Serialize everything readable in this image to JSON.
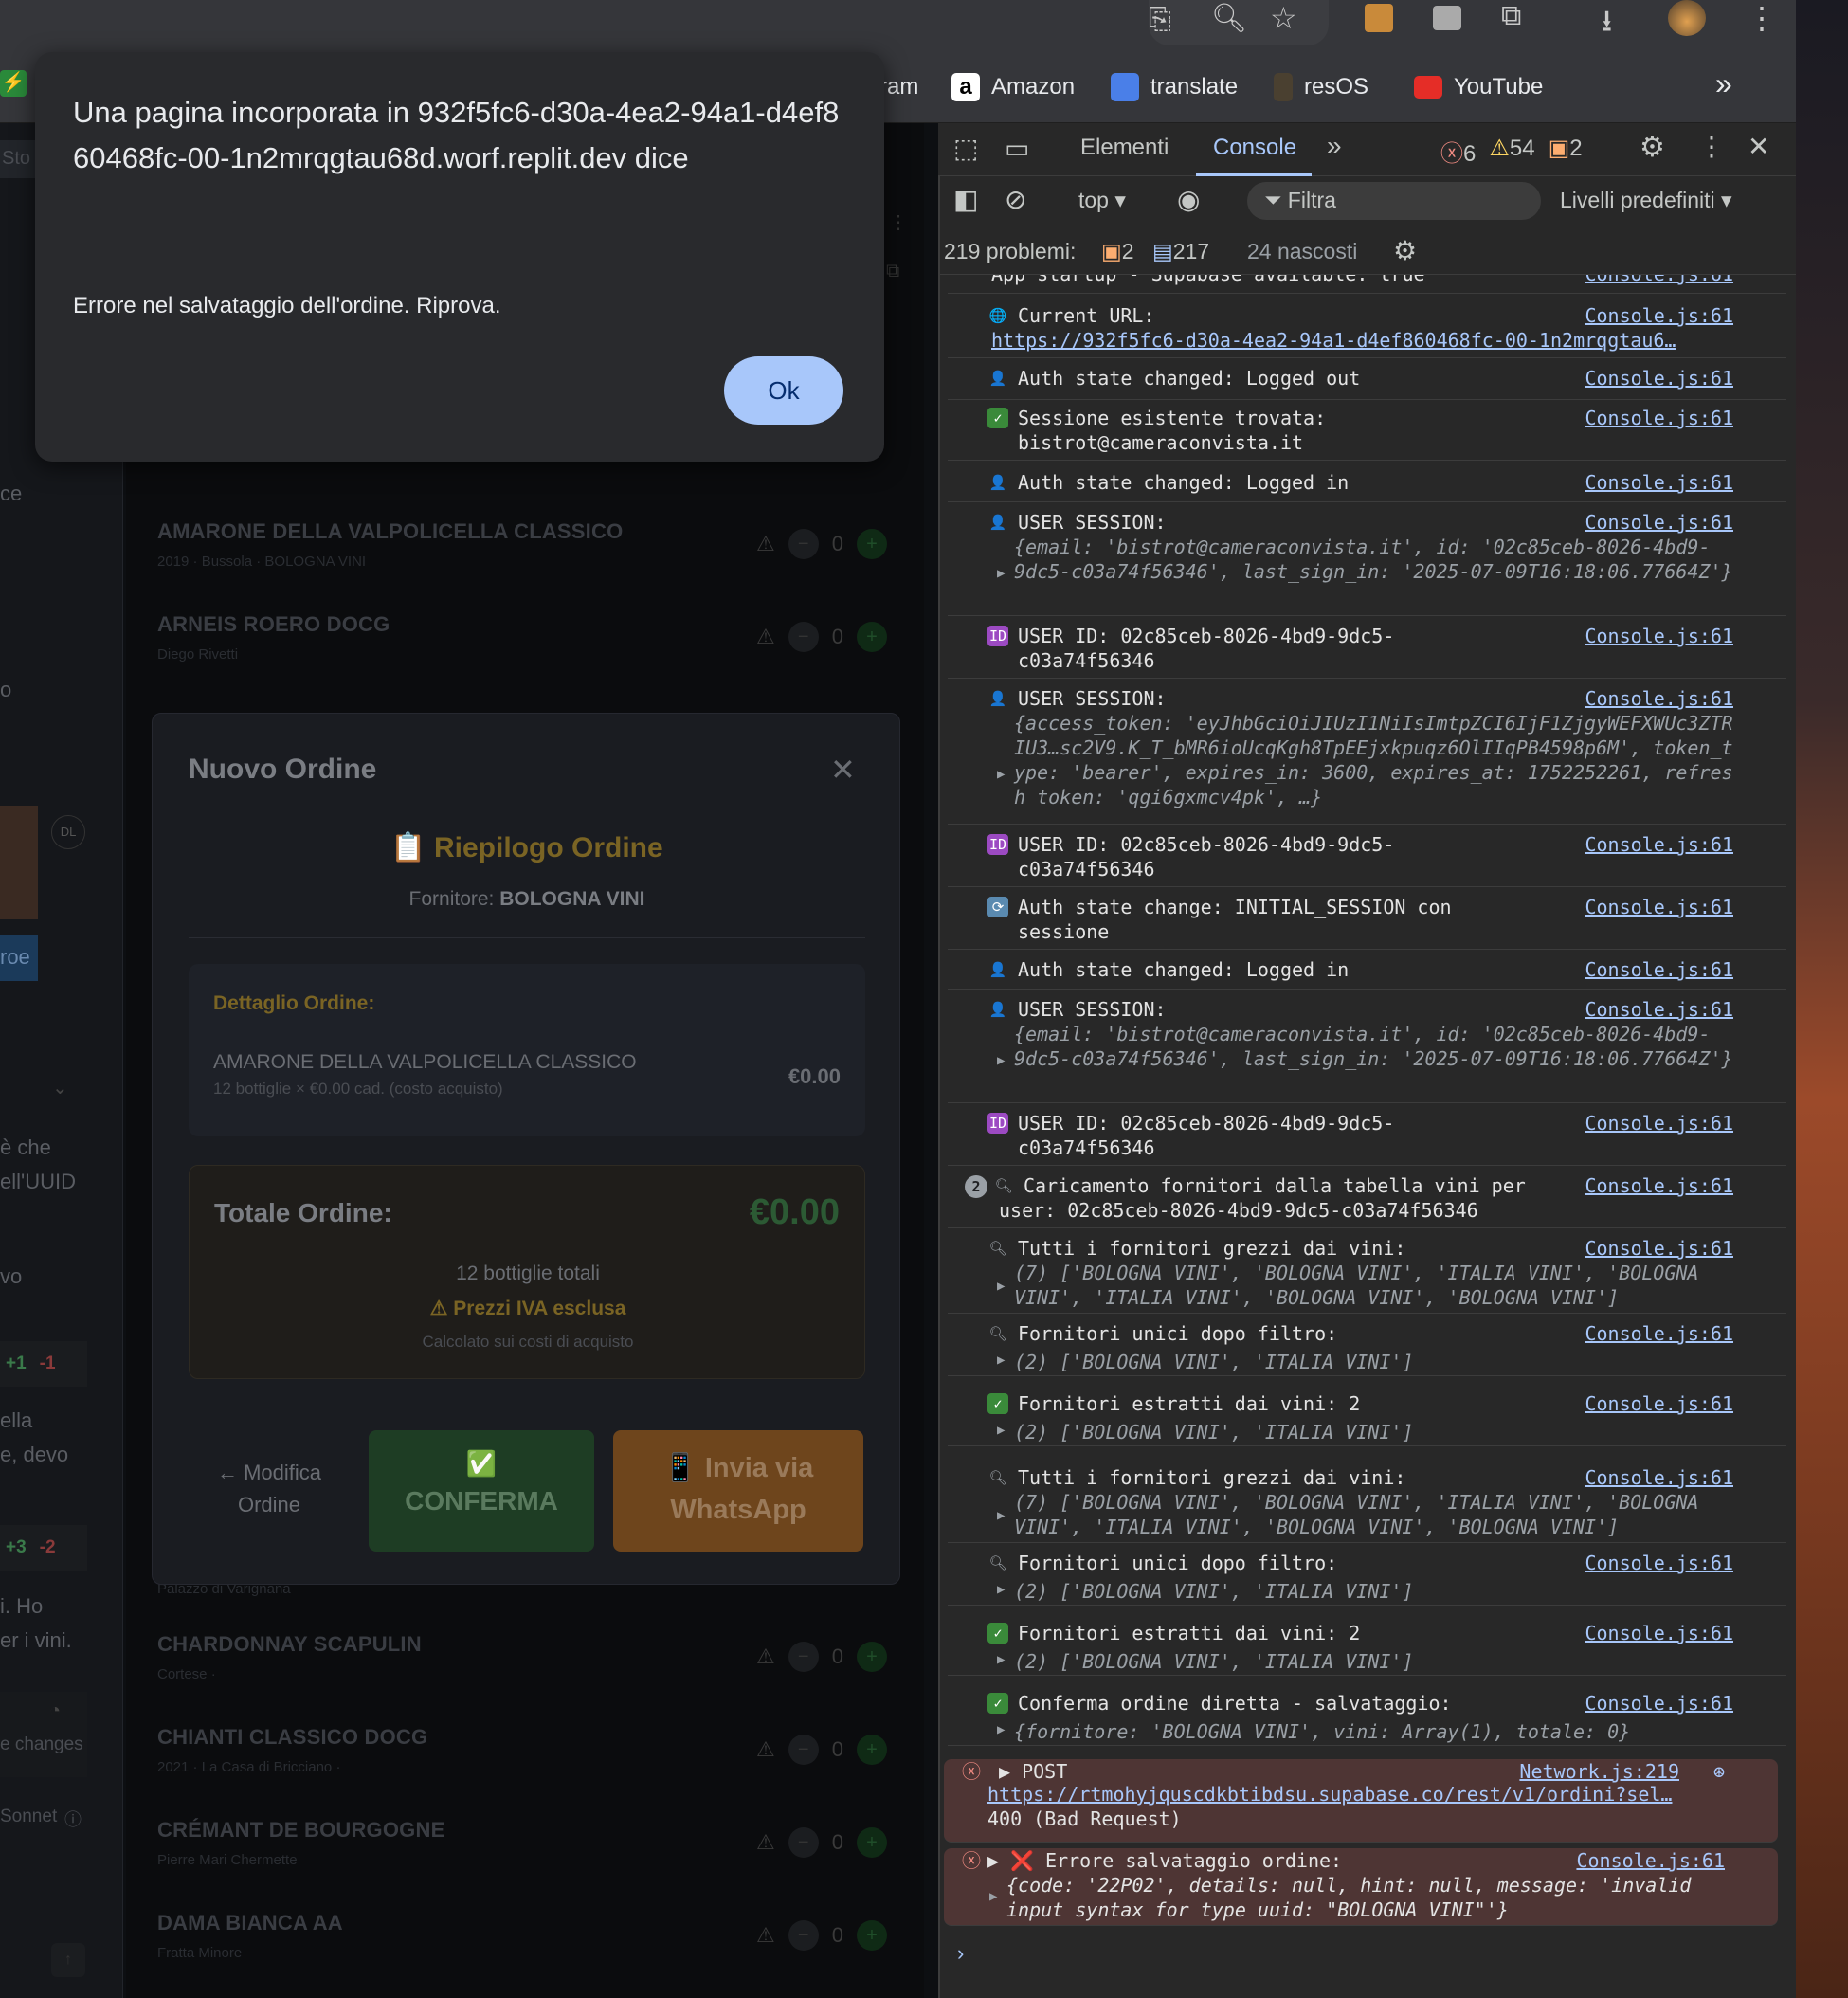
{
  "bookmarks": [
    "ram",
    "Amazon",
    "translate",
    "resOS",
    "YouTube"
  ],
  "alert": {
    "title": "Una pagina incorporata in 932f5fc6-d30a-4ea2-94a1-d4ef860468fc-00-1n2mrqgtau68d.worf.replit.dev dice",
    "message": "Errore nel salvataggio dell'ordine. Riprova.",
    "ok": "Ok"
  },
  "left_fragments": [
    "Sto",
    "ce",
    "o",
    "DL",
    "roe",
    "è che",
    "ell'UUID",
    "vo",
    "+1",
    "-1",
    "ella",
    "e, devo",
    "+3",
    "-2",
    "i. Ho",
    "er i vini.",
    "e changes",
    "Sonnet"
  ],
  "wines": [
    {
      "name": "AMARONE DELLA VALPOLICELLA CLASSICO",
      "meta": "2019  ·  Bussola  ·  BOLOGNA VINI",
      "qty": "0"
    },
    {
      "name": "ARNEIS ROERO DOCG",
      "meta": "Diego Rivetti",
      "qty": "0"
    },
    {
      "name": "CHARDONNAY SCAPULIN",
      "meta": "Cortese  ·",
      "qty": "0"
    },
    {
      "name": "CHIANTI CLASSICO DOCG",
      "meta": "2021  ·  La Casa di Bricciano  ·",
      "qty": "0"
    },
    {
      "name": "CRÉMANT DE BOURGOGNE",
      "meta": "Pierre Mari Chermette",
      "qty": "0"
    },
    {
      "name": "DAMA BIANCA AA",
      "meta": "Fratta Minore",
      "qty": "0"
    }
  ],
  "hidden_meta": "Palazzo di Varignana",
  "modal": {
    "title": "Nuovo Ordine",
    "summary_title": "📋 Riepilogo Ordine",
    "supplier_label": "Fornitore:",
    "supplier": "BOLOGNA VINI",
    "detail_title": "Dettaglio Ordine:",
    "item_name": "AMARONE DELLA VALPOLICELLA CLASSICO",
    "item_sub": "12 bottiglie × €0.00 cad. (costo acquisto)",
    "item_price": "€0.00",
    "total_label": "Totale Ordine:",
    "total_value": "€0.00",
    "bottles": "12 bottiglie totali",
    "vat": "⚠ Prezzi IVA esclusa",
    "calc": "Calcolato sui costi di acquisto",
    "btn_edit": "← Modifica Ordine",
    "btn_confirm_icon": "✅",
    "btn_confirm": "CONFERMA",
    "btn_whatsapp": "📱 Invia via WhatsApp"
  },
  "devtools": {
    "tabs": [
      "Elementi",
      "Console"
    ],
    "errors": "6",
    "warnings": "54",
    "issues": "2",
    "context": "top ▾",
    "filter": "Filtra",
    "levels": "Livelli predefiniti ▾",
    "problems": "219 problemi:",
    "problems_a": "2",
    "problems_b": "217",
    "hidden": "24 nascosti",
    "source": "Console.js:61",
    "network_source": "Network.js:219"
  },
  "logs": [
    {
      "icon": "",
      "text": "App startup - Supabase available: true"
    },
    {
      "icon": "globe",
      "text": "Current URL:",
      "link": "https://932f5fc6-d30a-4ea2-94a1-d4ef860468fc-00-1n2mrqgtau6…"
    },
    {
      "icon": "user",
      "text": "Auth state changed: Logged out"
    },
    {
      "icon": "check",
      "text": "Sessione esistente trovata: bistrot@cameraconvista.it"
    },
    {
      "icon": "user",
      "text": "Auth state changed: Logged in"
    },
    {
      "icon": "user",
      "text": "USER SESSION:",
      "obj": "{email: 'bistrot@cameraconvista.it', id: '02c85ceb-8026-4bd9-9dc5-c03a74f56346', last_sign_in: '2025-07-09T16:18:06.77664Z'}"
    },
    {
      "icon": "id",
      "text": "USER ID: 02c85ceb-8026-4bd9-9dc5-c03a74f56346"
    },
    {
      "icon": "user",
      "text": "USER SESSION:",
      "obj": "{access_token: 'eyJhbGciOiJIUzI1NiIsImtpZCI6IjF1ZjgyWEFXWUc3ZTRIU3…sc2V9.K_T_bMR6ioUcqKgh8TpEEjxkpuqz6OlIIqPB4598p6M', token_type: 'bearer', expires_in: 3600, expires_at: 1752252261, refresh_token: 'qgi6gxmcv4pk', …}"
    },
    {
      "icon": "id",
      "text": "USER ID: 02c85ceb-8026-4bd9-9dc5-c03a74f56346"
    },
    {
      "icon": "refresh",
      "text": "Auth state change: INITIAL_SESSION con sessione"
    },
    {
      "icon": "user",
      "text": "Auth state changed: Logged in"
    },
    {
      "icon": "user",
      "text": "USER SESSION:",
      "obj": "{email: 'bistrot@cameraconvista.it', id: '02c85ceb-8026-4bd9-9dc5-c03a74f56346', last_sign_in: '2025-07-09T16:18:06.77664Z'}"
    },
    {
      "icon": "id",
      "text": "USER ID: 02c85ceb-8026-4bd9-9dc5-c03a74f56346"
    },
    {
      "icon": "search",
      "count": "2",
      "text": "Caricamento fornitori dalla tabella vini per user: 02c85ceb-8026-4bd9-9dc5-c03a74f56346"
    },
    {
      "icon": "search",
      "text": "Tutti i fornitori grezzi dai vini:",
      "obj": "(7) ['BOLOGNA VINI', 'BOLOGNA VINI', 'ITALIA VINI', 'BOLOGNA VINI', 'ITALIA VINI', 'BOLOGNA VINI', 'BOLOGNA VINI']"
    },
    {
      "icon": "search",
      "text": "Fornitori unici dopo filtro:",
      "obj": "(2) ['BOLOGNA VINI', 'ITALIA VINI']"
    },
    {
      "icon": "check",
      "text": "Fornitori estratti dai vini: 2",
      "obj": "(2) ['BOLOGNA VINI', 'ITALIA VINI']"
    },
    {
      "icon": "search",
      "text": "Tutti i fornitori grezzi dai vini:",
      "obj": "(7) ['BOLOGNA VINI', 'BOLOGNA VINI', 'ITALIA VINI', 'BOLOGNA VINI', 'ITALIA VINI', 'BOLOGNA VINI', 'BOLOGNA VINI']"
    },
    {
      "icon": "search",
      "text": "Fornitori unici dopo filtro:",
      "obj": "(2) ['BOLOGNA VINI', 'ITALIA VINI']"
    },
    {
      "icon": "check",
      "text": "Fornitori estratti dai vini: 2",
      "obj": "(2) ['BOLOGNA VINI', 'ITALIA VINI']"
    },
    {
      "icon": "check",
      "text": "Conferma ordine diretta - salvataggio:",
      "obj": "{fornitore: 'BOLOGNA VINI', vini: Array(1), totale: 0}"
    },
    {
      "icon": "error",
      "text": "▶ POST",
      "link": "https://rtmohyjquscdkbtibdsu.supabase.co/rest/v1/ordini?sel…",
      "extra": "400 (Bad Request)"
    },
    {
      "icon": "error",
      "text": "▶ ❌ Errore salvataggio ordine:",
      "obj": "{code: '22P02', details: null, hint: null, message: 'invalid input syntax for type uuid: \"BOLOGNA VINI\"'}"
    }
  ],
  "colors": {
    "accent": "#a8c7fa",
    "gold": "#7a6424",
    "green": "#1e4a2c",
    "orange": "#7a4a1a"
  }
}
